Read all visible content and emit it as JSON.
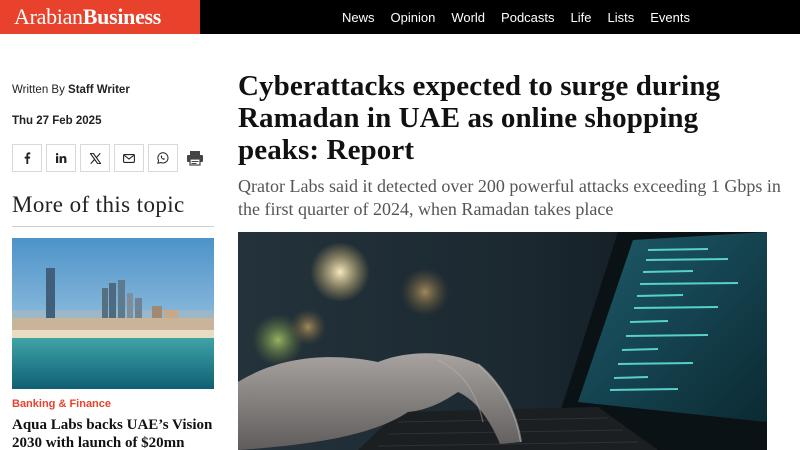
{
  "brand": {
    "logo_light": "Arabian",
    "logo_bold": "Business",
    "accent_color": "#e8412c"
  },
  "nav": {
    "items": [
      {
        "label": "News"
      },
      {
        "label": "Opinion"
      },
      {
        "label": "World"
      },
      {
        "label": "Podcasts"
      },
      {
        "label": "Life"
      },
      {
        "label": "Lists"
      },
      {
        "label": "Events"
      }
    ]
  },
  "article": {
    "byline_prefix": "Written By",
    "author": "Staff Writer",
    "date": "Thu 27 Feb 2025",
    "headline": "Cyberattacks expected to surge during Ramadan in UAE as online shopping peaks: Report",
    "subhead": "Qrator Labs said it detected over 200 powerful attacks exceeding 1 Gbps in the first quarter of 2024, when Ramadan takes place"
  },
  "share": {
    "icons": [
      "facebook-icon",
      "linkedin-icon",
      "x-icon",
      "email-icon",
      "whatsapp-icon",
      "print-icon"
    ]
  },
  "sidebar": {
    "heading": "More of this topic",
    "related": [
      {
        "category": "Banking & Finance",
        "title": "Aqua Labs backs UAE’s Vision 2030 with launch of $20mn"
      }
    ]
  }
}
